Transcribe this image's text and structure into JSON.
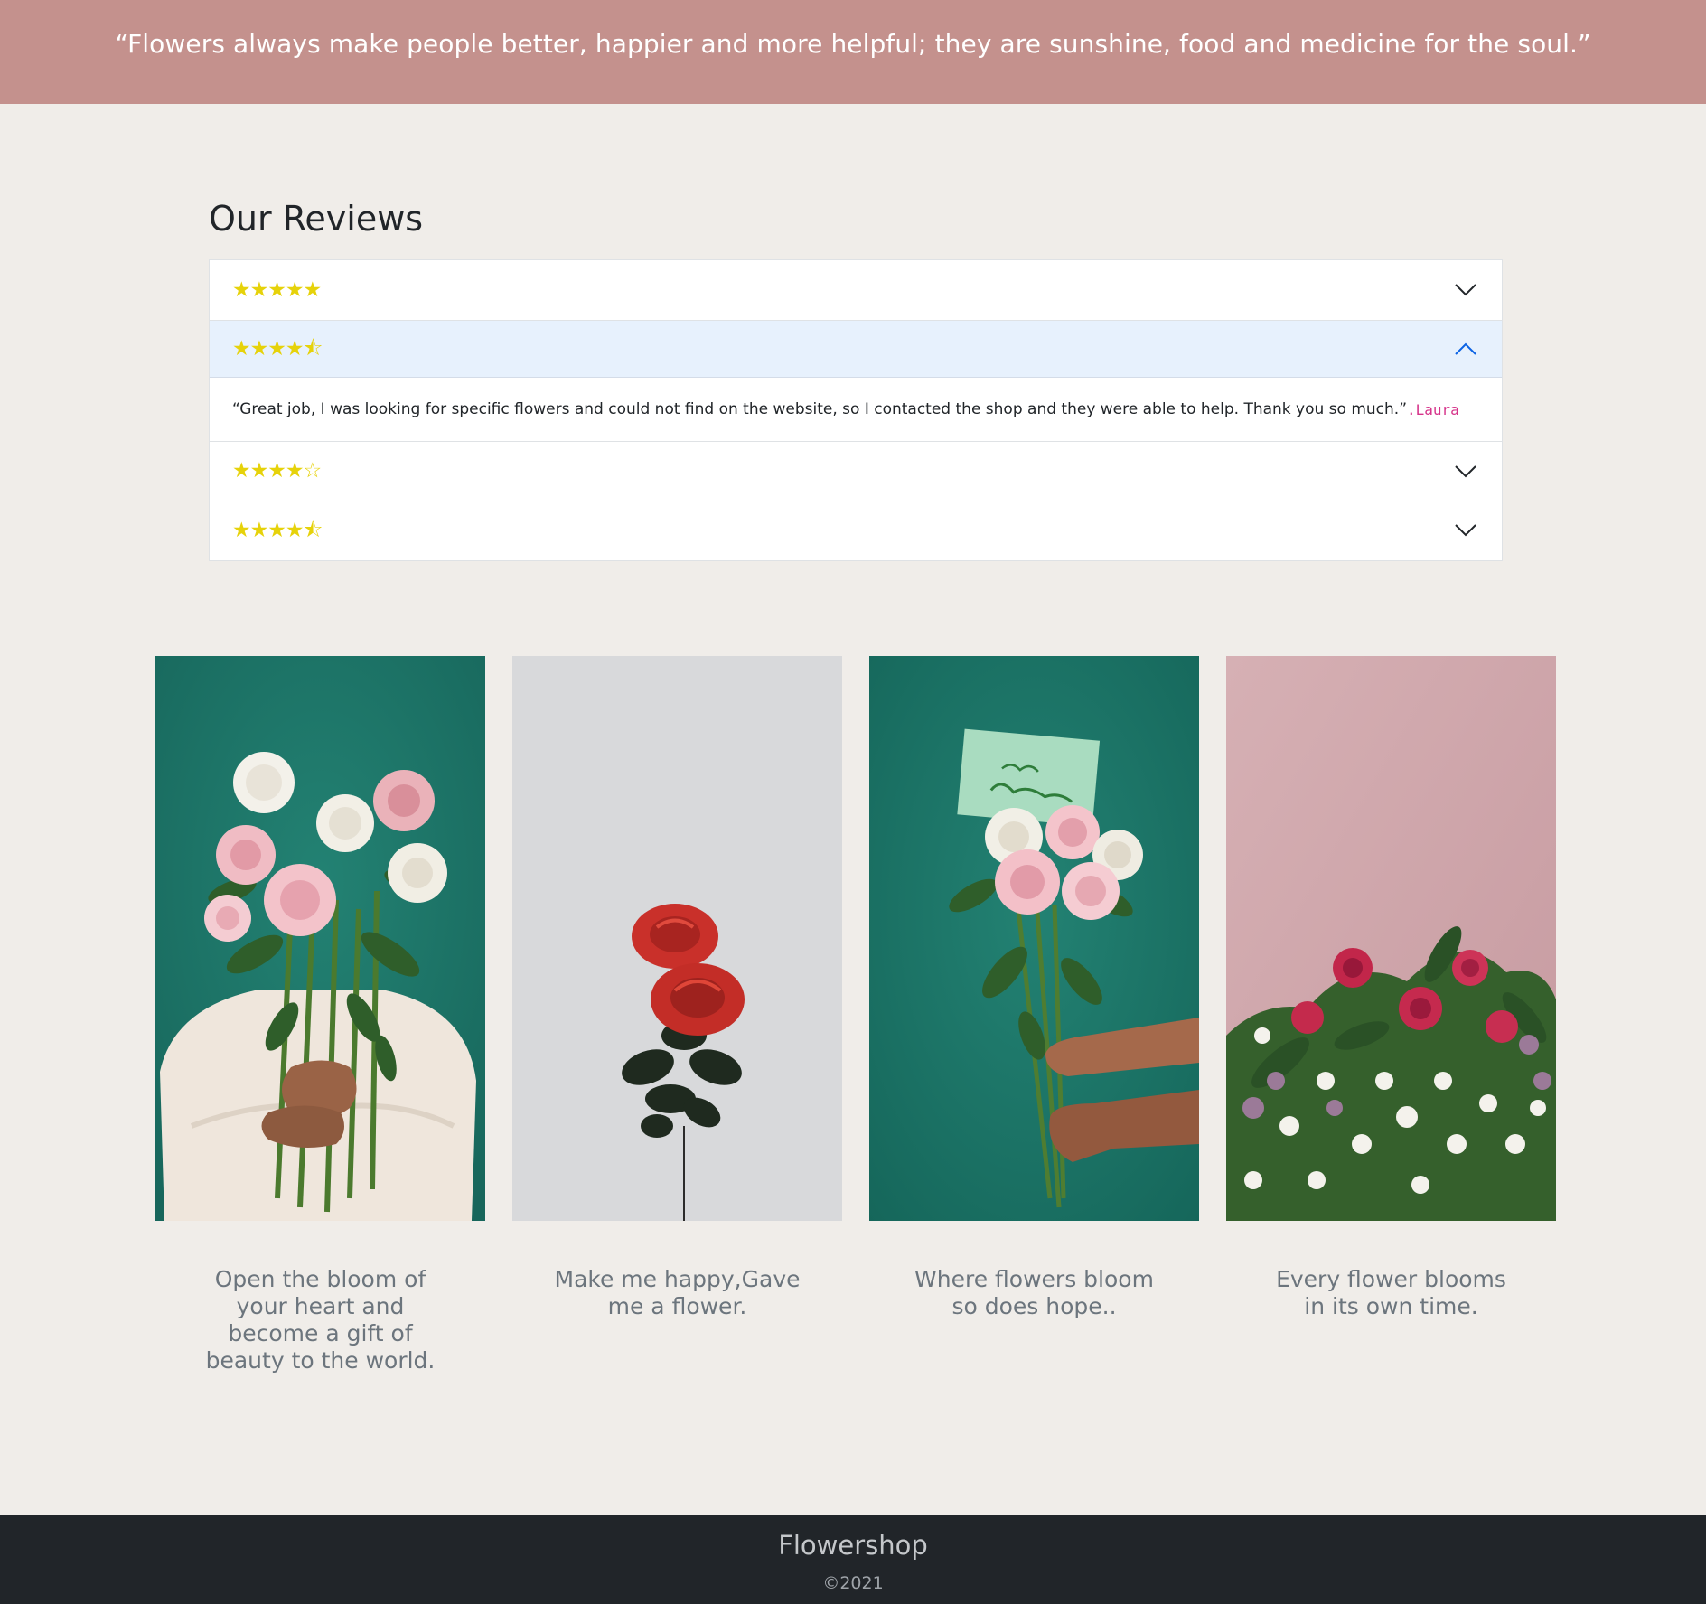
{
  "banner": {
    "quote": "“Flowers always make people better, happier and more helpful; they are sunshine, food and medicine for the soul.”"
  },
  "reviews": {
    "title": "Our Reviews",
    "items": [
      {
        "rating": 5,
        "stars": "★★★★★",
        "expanded": false
      },
      {
        "rating": 4.5,
        "stars": "★★★★⯪",
        "expanded": true,
        "text": "“Great job, I was looking for specific flowers and could not find on the website, so I contacted the shop and they were able to help. Thank you so much.”",
        "author": ".Laura"
      },
      {
        "rating": 4,
        "stars": "★★★★☆",
        "expanded": false
      },
      {
        "rating": 4.5,
        "stars": "★★★★⯪",
        "expanded": false
      }
    ],
    "star_color": "#e6d20a",
    "active_header_color": "#e7f1fd"
  },
  "gallery": {
    "cards": [
      {
        "image": "woman-holding-rose-bouquet-photo",
        "caption": "Open the bloom of your heart and become a gift of beauty to the world."
      },
      {
        "image": "single-red-roses-photo",
        "caption": "Make me happy,Gave me a flower."
      },
      {
        "image": "happy-birthday-bouquet-photo",
        "caption": "Where flowers bloom so does hope.."
      },
      {
        "image": "mixed-flowers-pink-background-photo",
        "caption": "Every flower blooms in its own time."
      }
    ]
  },
  "footer": {
    "brand": "Flowershop",
    "copyright": "©2021"
  },
  "colors": {
    "banner": "#c4918d",
    "page_background": "#f0ede9",
    "footer_background": "#212529",
    "author_accent": "#d6338a"
  }
}
